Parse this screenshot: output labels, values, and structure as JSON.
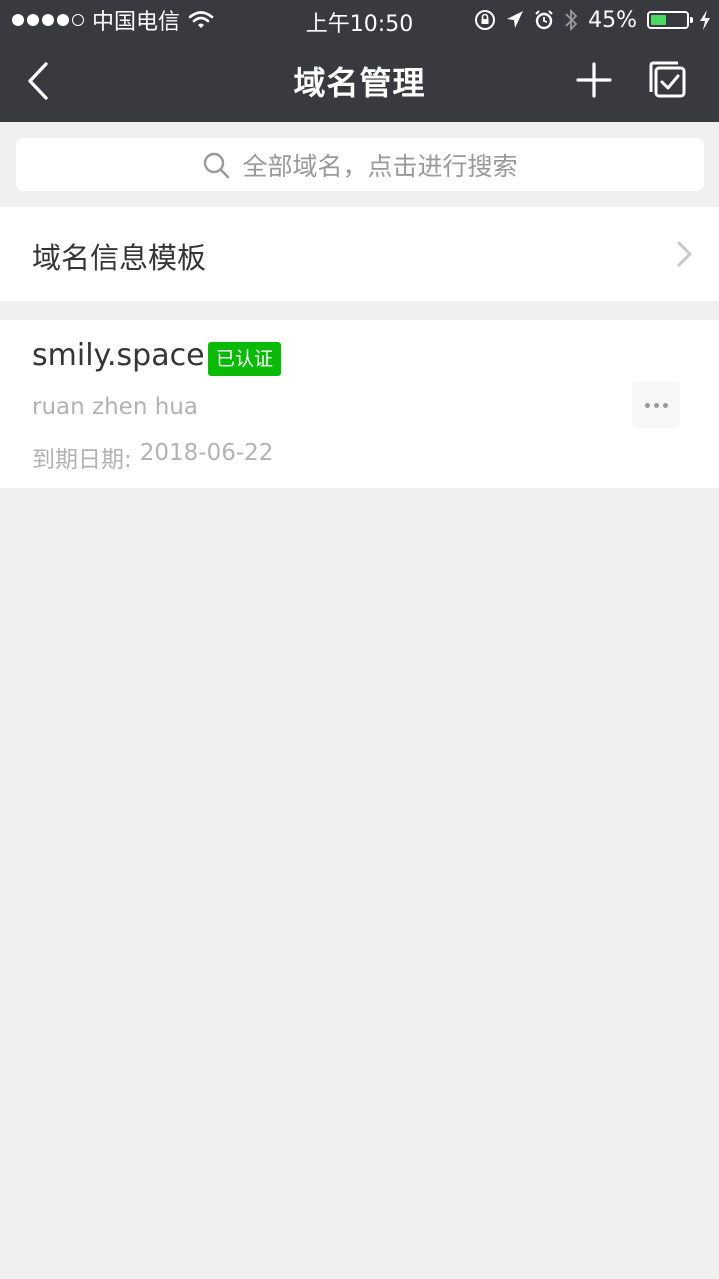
{
  "status_bar": {
    "carrier": "中国电信",
    "time": "上午10:50",
    "battery_percent": "45%",
    "battery_level": 0.45,
    "signal_bars_filled": 4,
    "signal_bars_total": 5
  },
  "nav": {
    "title": "域名管理"
  },
  "search": {
    "placeholder": "全部域名，点击进行搜索"
  },
  "template_row": {
    "label": "域名信息模板"
  },
  "domains": [
    {
      "name": "smily.space",
      "badge": "已认证",
      "owner": "ruan zhen hua",
      "expiry_label": "到期日期:",
      "expiry_date": "2018-06-22"
    }
  ],
  "colors": {
    "header_bg": "#393a3f",
    "page_bg": "#f0f0f0",
    "badge_green": "#09bb07",
    "battery_green": "#4cd964"
  },
  "icons": {
    "back": "chevron-left-icon",
    "add": "plus-icon",
    "select": "multi-select-check-icon",
    "search": "search-icon",
    "chevron": "chevron-right-icon",
    "more": "more-dots-icon"
  }
}
